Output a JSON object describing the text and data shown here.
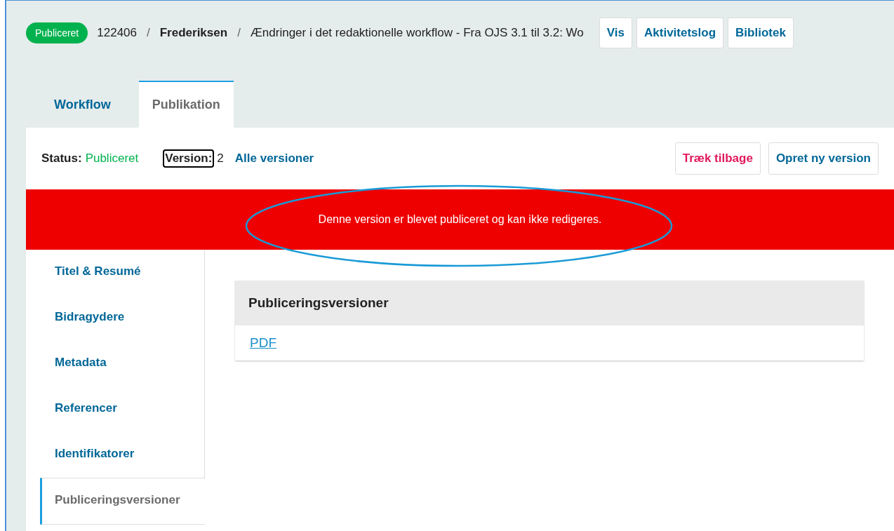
{
  "header": {
    "status_badge": "Publiceret",
    "submission_id": "122406",
    "separator_1": "/",
    "author": "Frederiksen",
    "separator_2": "/",
    "title": "Ændringer i det redaktionelle workflow - Fra OJS 3.1 til 3.2: Wo",
    "buttons": [
      "Vis",
      "Aktivitetslog",
      "Bibliotek"
    ]
  },
  "tabs": [
    {
      "label": "Workflow",
      "selected": false
    },
    {
      "label": "Publikation",
      "selected": true
    }
  ],
  "publication_bar": {
    "status_label": "Status:",
    "status_value": "Publiceret",
    "version_label": "Version:",
    "version_label_highlighted": true,
    "version_value": "2",
    "all_versions_link": "Alle versioner",
    "buttons": [
      {
        "label": "Træk tilbage",
        "kind": "danger"
      },
      {
        "label": "Opret ny version",
        "kind": "primary"
      }
    ]
  },
  "notice": {
    "text": "Denne version er blevet publiceret og kan ikke redigeres.",
    "circled": true
  },
  "sidebar": {
    "items": [
      {
        "label": "Titel & Resumé",
        "selected": false
      },
      {
        "label": "Bidragydere",
        "selected": false
      },
      {
        "label": "Metadata",
        "selected": false
      },
      {
        "label": "Referencer",
        "selected": false
      },
      {
        "label": "Identifikatorer",
        "selected": false
      },
      {
        "label": "Publiceringsversioner",
        "selected": true
      }
    ]
  },
  "panel": {
    "title": "Publiceringsversioner",
    "links": [
      "PDF"
    ]
  }
}
